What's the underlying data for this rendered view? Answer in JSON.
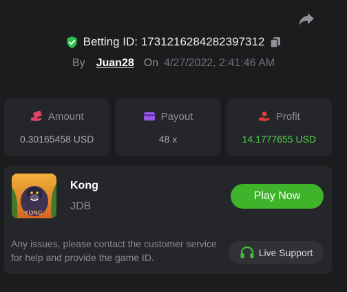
{
  "header": {
    "betting_id_label": "Betting ID: 1731216284282397312",
    "by_label": "By",
    "username": "Juan28",
    "on_label": "On",
    "datetime": "4/27/2022, 2:41:46 AM"
  },
  "stats": {
    "amount": {
      "label": "Amount",
      "value": "0.30165458 USD",
      "icon": "money-hand-icon",
      "color": "#e0466b"
    },
    "payout": {
      "label": "Payout",
      "value": "48 x",
      "icon": "card-icon",
      "color": "#9a56e8"
    },
    "profit": {
      "label": "Profit",
      "value": "14.1777655 USD",
      "icon": "hand-coins-icon",
      "color": "#e03a3a",
      "value_color": "#4fd14a"
    }
  },
  "game": {
    "title": "Kong",
    "provider": "JDB",
    "thumbnail_text": "KONG",
    "play_label": "Play Now",
    "note": "Any issues, please contact the customer service for help and provide the game ID.",
    "support_label": "Live Support"
  },
  "colors": {
    "background": "#1b1c1e",
    "card": "#25262a",
    "accent_green": "#3fb32a",
    "shield_green": "#2fbf4f"
  }
}
